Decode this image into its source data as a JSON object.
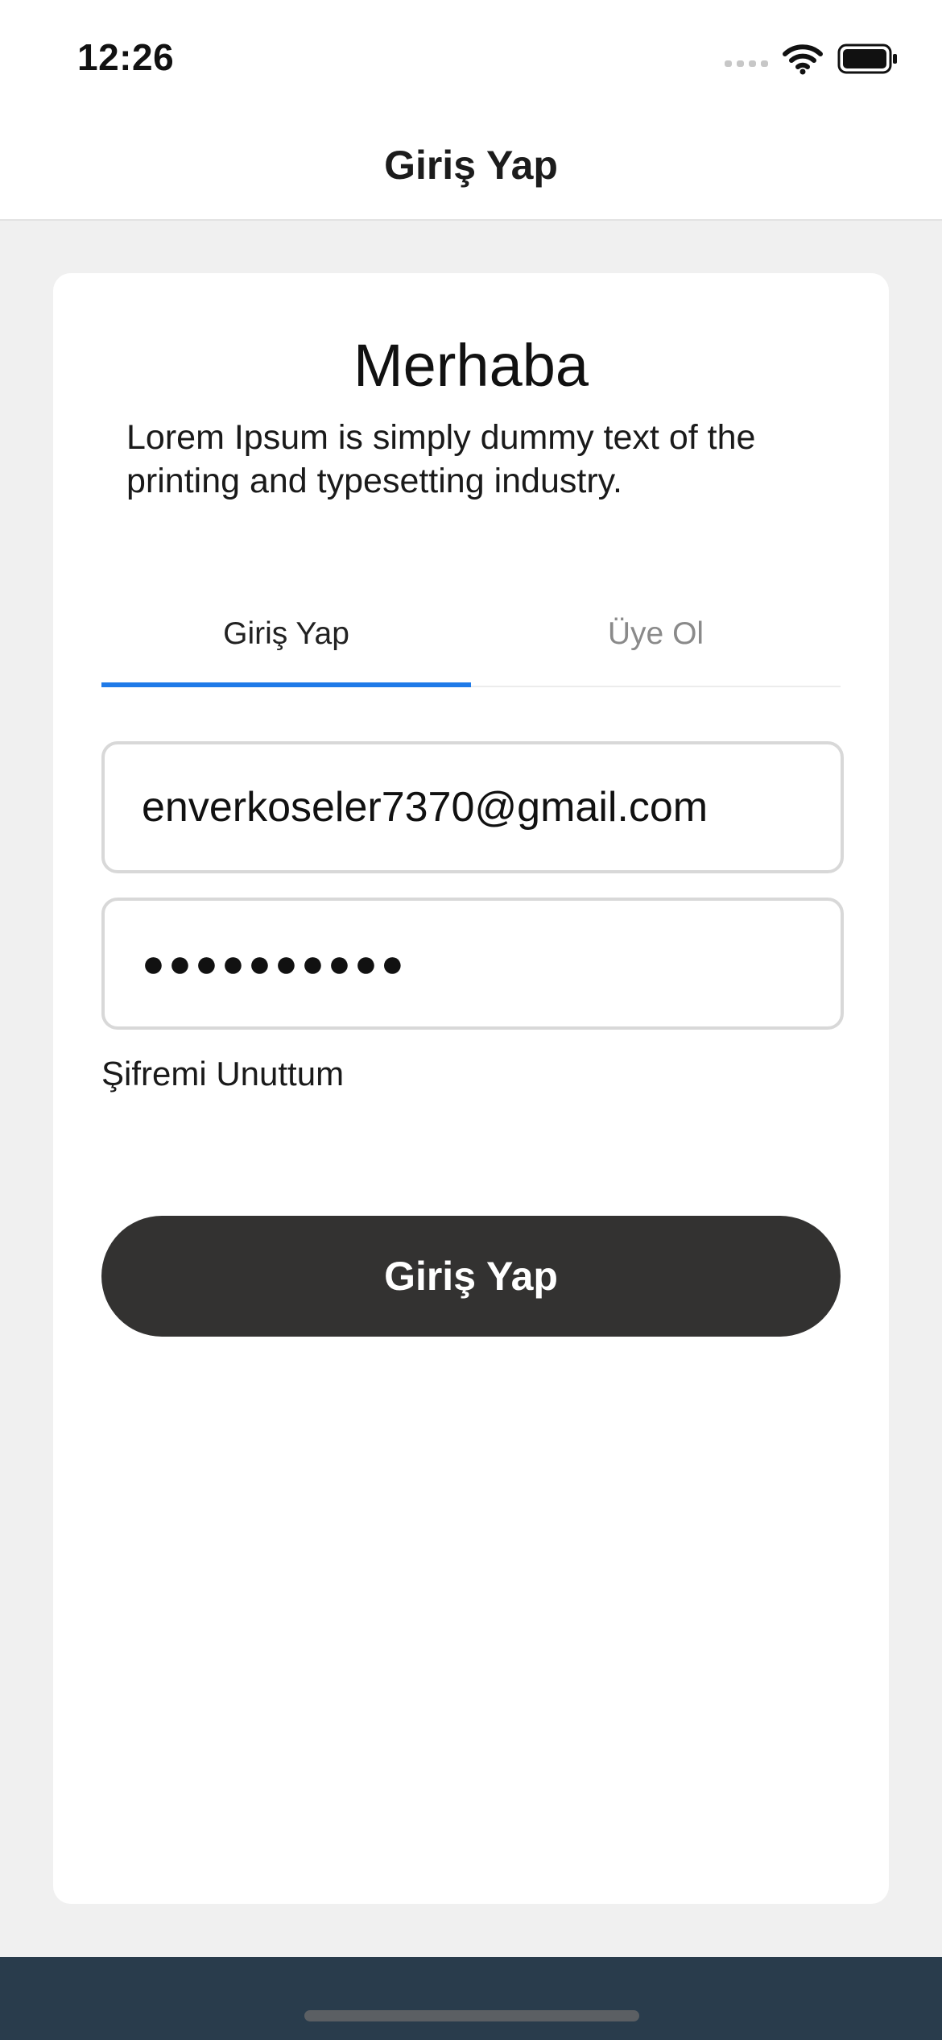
{
  "status_bar": {
    "time": "12:26",
    "icons": [
      "cellular-signal-icon",
      "wifi-icon",
      "battery-icon"
    ]
  },
  "nav": {
    "title": "Giriş Yap"
  },
  "card": {
    "title": "Merhaba",
    "description": "Lorem Ipsum is simply dummy text of the printing and typesetting industry."
  },
  "tabs": [
    {
      "label": "Giriş Yap",
      "active": true
    },
    {
      "label": "Üye Ol",
      "active": false
    }
  ],
  "form": {
    "email_value": "enverkoseler7370@gmail.com",
    "password_value": "●●●●●●●●●●",
    "forgot_label": "Şifremi Unuttum",
    "submit_label": "Giriş Yap"
  },
  "colors": {
    "accent": "#1f7ae8",
    "button_bg": "#333231",
    "bottom_bar": "#293c4c",
    "page_bg": "#f0f0f0"
  }
}
